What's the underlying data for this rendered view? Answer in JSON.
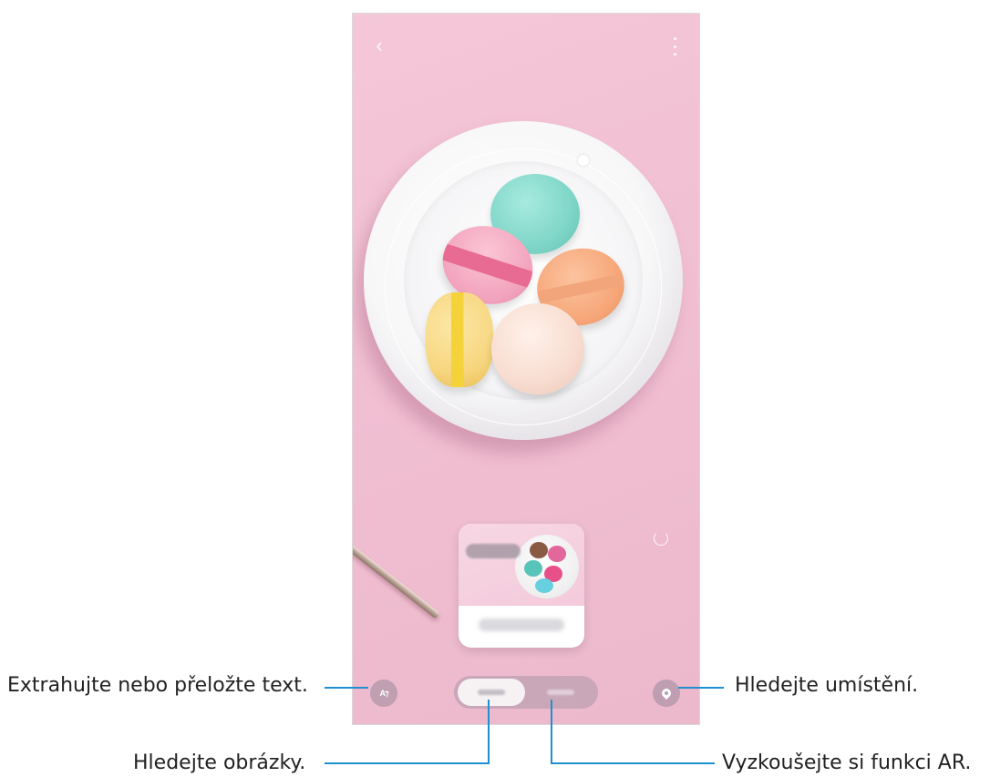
{
  "callouts": {
    "extract_text": "Extrahujte nebo přeložte text.",
    "search_location": "Hledejte umístění.",
    "search_images": "Hledejte obrázky.",
    "try_ar": "Vyzkoušejte si funkci AR."
  },
  "screen": {
    "top_bar": {
      "back_icon": "chevron-left-icon",
      "more_icon": "more-vertical-icon"
    },
    "bottom_bar": {
      "translate_button": {
        "icon": "translate-icon",
        "glyph": "A⁊"
      },
      "location_button": {
        "icon": "location-pin-icon"
      },
      "mode_selector": {
        "selected": "images"
      }
    }
  },
  "colors": {
    "callout_line": "#1e8fd0",
    "background": "#f3c3d5"
  }
}
